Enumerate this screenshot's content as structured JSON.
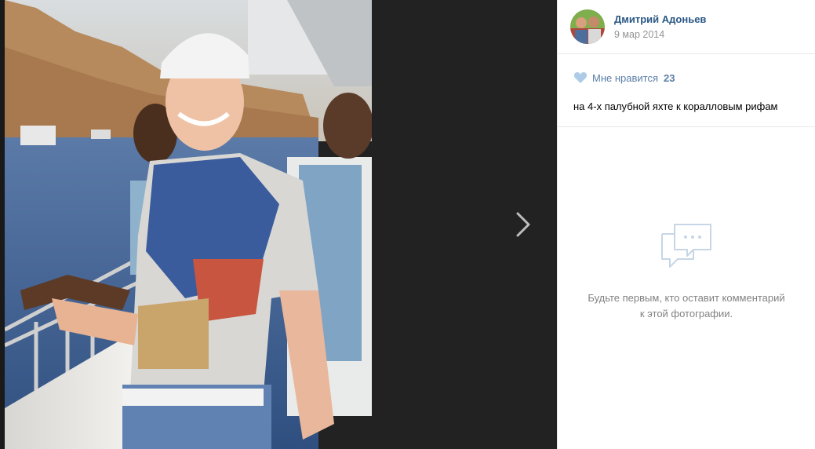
{
  "author": {
    "name": "Дмитрий Адоньев",
    "date": "9 мар 2014"
  },
  "likes": {
    "label": "Мне нравится",
    "count": "23",
    "icon": "heart-icon"
  },
  "caption": "на 4-х палубной яхте к коралловым рифам",
  "comments": {
    "empty_text": "Будьте первым, кто оставит комментарий к этой фотографии.",
    "icon": "comments-icon"
  },
  "navigation": {
    "next_icon": "chevron-right-icon"
  },
  "colors": {
    "link": "#2a5885",
    "likes": "#5a7ea6",
    "muted": "#828282",
    "background": "#222222"
  }
}
